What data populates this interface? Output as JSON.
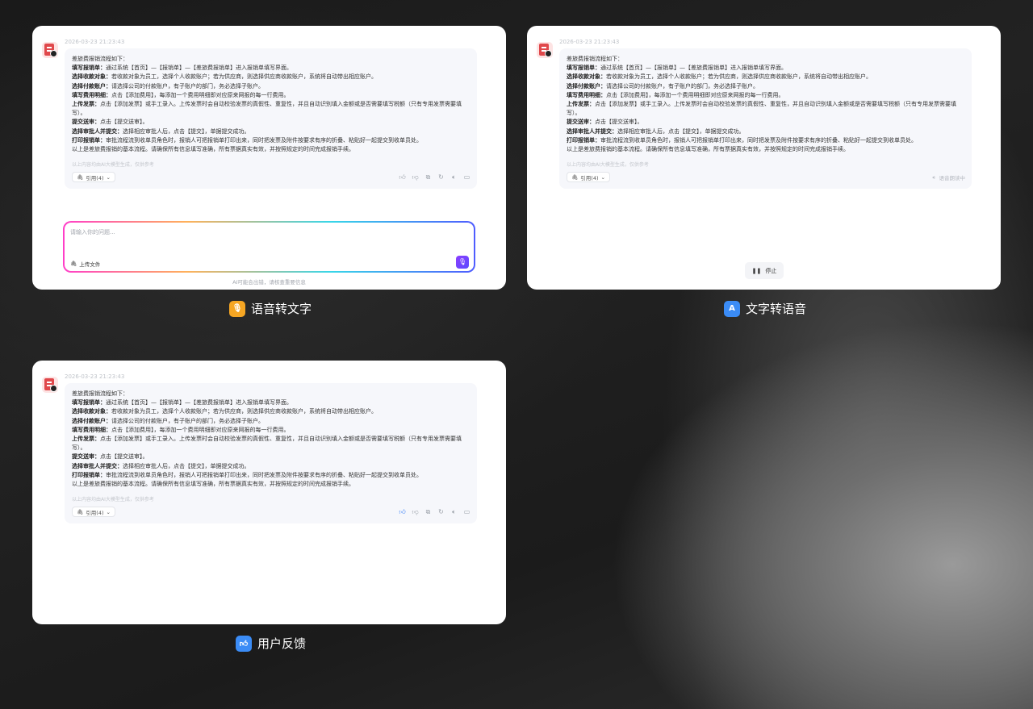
{
  "message": {
    "timestamp": "2026-03-23 21:23:43",
    "lines": [
      {
        "key": "",
        "text": "差旅费报销流程如下："
      },
      {
        "key": "填写报销单：",
        "text": "通过系统【首页】—【报销单】—【差旅费报销单】进入报销单填写界面。"
      },
      {
        "key": "选择收款对象：",
        "text": "若收款对象为员工，选择个人收款账户；若为供应商，则选择供应商收款账户，系统将自动带出相应账户。"
      },
      {
        "key": "选择付款账户：",
        "text": "请选择公司的付款账户，有子账户的部门，务必选择子账户。"
      },
      {
        "key": "填写费用明细：",
        "text": "点击【添加费用】，每添加一个费用明细即对应原来网报的每一行费用。"
      },
      {
        "key": "上传发票：",
        "text": "点击【添加发票】或手工录入。上传发票时会自动校验发票的真假性、重复性，并且自动识别填入金额或是否需要填写税额（只有专用发票需要填写）。"
      },
      {
        "key": "提交送审：",
        "text": "点击【提交送审】。"
      },
      {
        "key": "选择审批人并提交：",
        "text": "选择相应审批人后，点击【提交】，单据提交成功。"
      },
      {
        "key": "打印报销单：",
        "text": "审批流程流到收单员角色时，报销人可把报销单打印出来，同时把发票及附件按要求有序的折叠、粘贴好一起提交到收单员处。"
      },
      {
        "key": "",
        "text": "以上是差旅费报销的基本流程。请确保所有信息填写准确，所有票据真实有效，并按照规定的时间完成报销手续。"
      }
    ],
    "disclaimer": "以上内容均由AI大模型生成，仅供参考",
    "cite_label": "引用(4)",
    "cite_chevron": "⌄"
  },
  "panel1": {
    "input_placeholder": "请输入你的问题...",
    "upload_label": "上传文件",
    "footer_hint": "AI可能会出错，请核查重要信息",
    "caption": "语音转文字"
  },
  "panel2": {
    "reading_status": "语音朗读中",
    "stop_label": "停止",
    "caption": "文字转语音"
  },
  "panel3": {
    "caption": "用户反馈"
  },
  "colors": {
    "caption1_icon": "#f6a623",
    "caption2_icon": "#3b8cf6",
    "caption3_icon": "#3b8cf6",
    "like_active": "#3b82f6"
  }
}
